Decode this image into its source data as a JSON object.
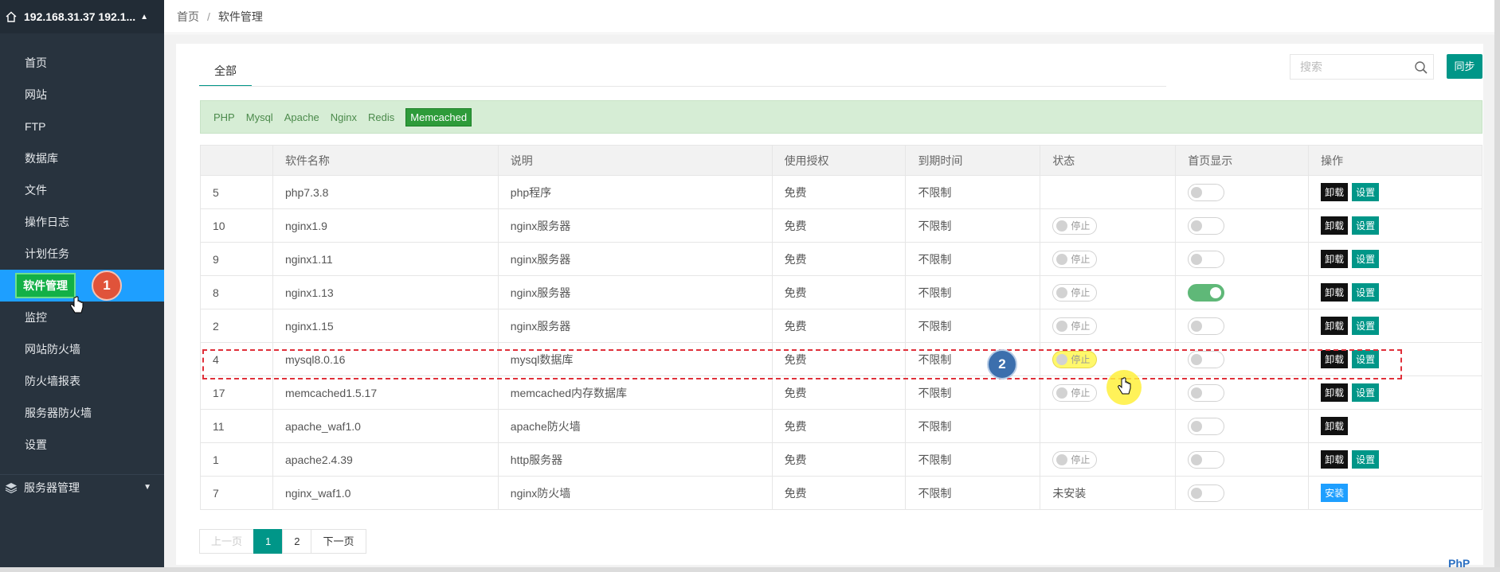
{
  "sidebar": {
    "server_name": "192.168.31.37 192.1...",
    "items": [
      {
        "label": "首页"
      },
      {
        "label": "网站"
      },
      {
        "label": "FTP"
      },
      {
        "label": "数据库"
      },
      {
        "label": "文件"
      },
      {
        "label": "操作日志"
      },
      {
        "label": "计划任务"
      },
      {
        "label": "软件管理",
        "active": true
      },
      {
        "label": "监控"
      },
      {
        "label": "网站防火墙"
      },
      {
        "label": "防火墙报表"
      },
      {
        "label": "服务器防火墙"
      },
      {
        "label": "设置"
      }
    ],
    "group_label": "服务器管理"
  },
  "breadcrumb": {
    "home": "首页",
    "separator": "/",
    "current": "软件管理"
  },
  "tabs": {
    "all": "全部"
  },
  "search": {
    "placeholder": "搜索"
  },
  "sync_label": "同步",
  "filters": [
    "PHP",
    "Mysql",
    "Apache",
    "Nginx",
    "Redis",
    "Memcached"
  ],
  "active_filter": "Memcached",
  "table": {
    "columns": [
      "",
      "软件名称",
      "说明",
      "使用授权",
      "到期时间",
      "状态",
      "首页显示",
      "操作"
    ],
    "rows": [
      {
        "id": "5",
        "name": "php7.3.8",
        "desc": "php程序",
        "license": "免费",
        "expire": "不限制",
        "status": "",
        "home_on": false,
        "actions": [
          "卸载",
          "设置"
        ]
      },
      {
        "id": "10",
        "name": "nginx1.9",
        "desc": "nginx服务器",
        "license": "免费",
        "expire": "不限制",
        "status": "停止",
        "home_on": false,
        "actions": [
          "卸载",
          "设置"
        ]
      },
      {
        "id": "9",
        "name": "nginx1.11",
        "desc": "nginx服务器",
        "license": "免费",
        "expire": "不限制",
        "status": "停止",
        "home_on": false,
        "actions": [
          "卸载",
          "设置"
        ]
      },
      {
        "id": "8",
        "name": "nginx1.13",
        "desc": "nginx服务器",
        "license": "免费",
        "expire": "不限制",
        "status": "停止",
        "home_on": true,
        "actions": [
          "卸载",
          "设置"
        ]
      },
      {
        "id": "2",
        "name": "nginx1.15",
        "desc": "nginx服务器",
        "license": "免费",
        "expire": "不限制",
        "status": "停止",
        "home_on": false,
        "actions": [
          "卸载",
          "设置"
        ]
      },
      {
        "id": "4",
        "name": "mysql8.0.16",
        "desc": "mysql数据库",
        "license": "免费",
        "expire": "不限制",
        "status": "停止",
        "home_on": false,
        "actions": [
          "卸载",
          "设置"
        ]
      },
      {
        "id": "17",
        "name": "memcached1.5.17",
        "desc": "memcached内存数据库",
        "license": "免费",
        "expire": "不限制",
        "status": "停止",
        "home_on": false,
        "actions": [
          "卸载",
          "设置"
        ]
      },
      {
        "id": "11",
        "name": "apache_waf1.0",
        "desc": "apache防火墙",
        "license": "免费",
        "expire": "不限制",
        "status": "",
        "home_on": false,
        "actions": [
          "卸载"
        ]
      },
      {
        "id": "1",
        "name": "apache2.4.39",
        "desc": "http服务器",
        "license": "免费",
        "expire": "不限制",
        "status": "停止",
        "home_on": false,
        "actions": [
          "卸载",
          "设置"
        ]
      },
      {
        "id": "7",
        "name": "nginx_waf1.0",
        "desc": "nginx防火墙",
        "license": "免费",
        "expire": "不限制",
        "status_text": "未安装",
        "home_on": false,
        "actions": [
          "安装"
        ]
      }
    ]
  },
  "pagination": {
    "prev": "上一页",
    "pages": [
      "1",
      "2"
    ],
    "current": "1",
    "next": "下一页"
  },
  "annotations": {
    "step1": "1",
    "step2": "2"
  },
  "watermark": "PhP",
  "colors": {
    "sidebar_bg": "#28333e",
    "active_item": "#1e9fff",
    "primary": "#009688",
    "filter_bg": "#d6edd5",
    "highlight": "#fff86b",
    "annotation_red": "#e0303a"
  }
}
